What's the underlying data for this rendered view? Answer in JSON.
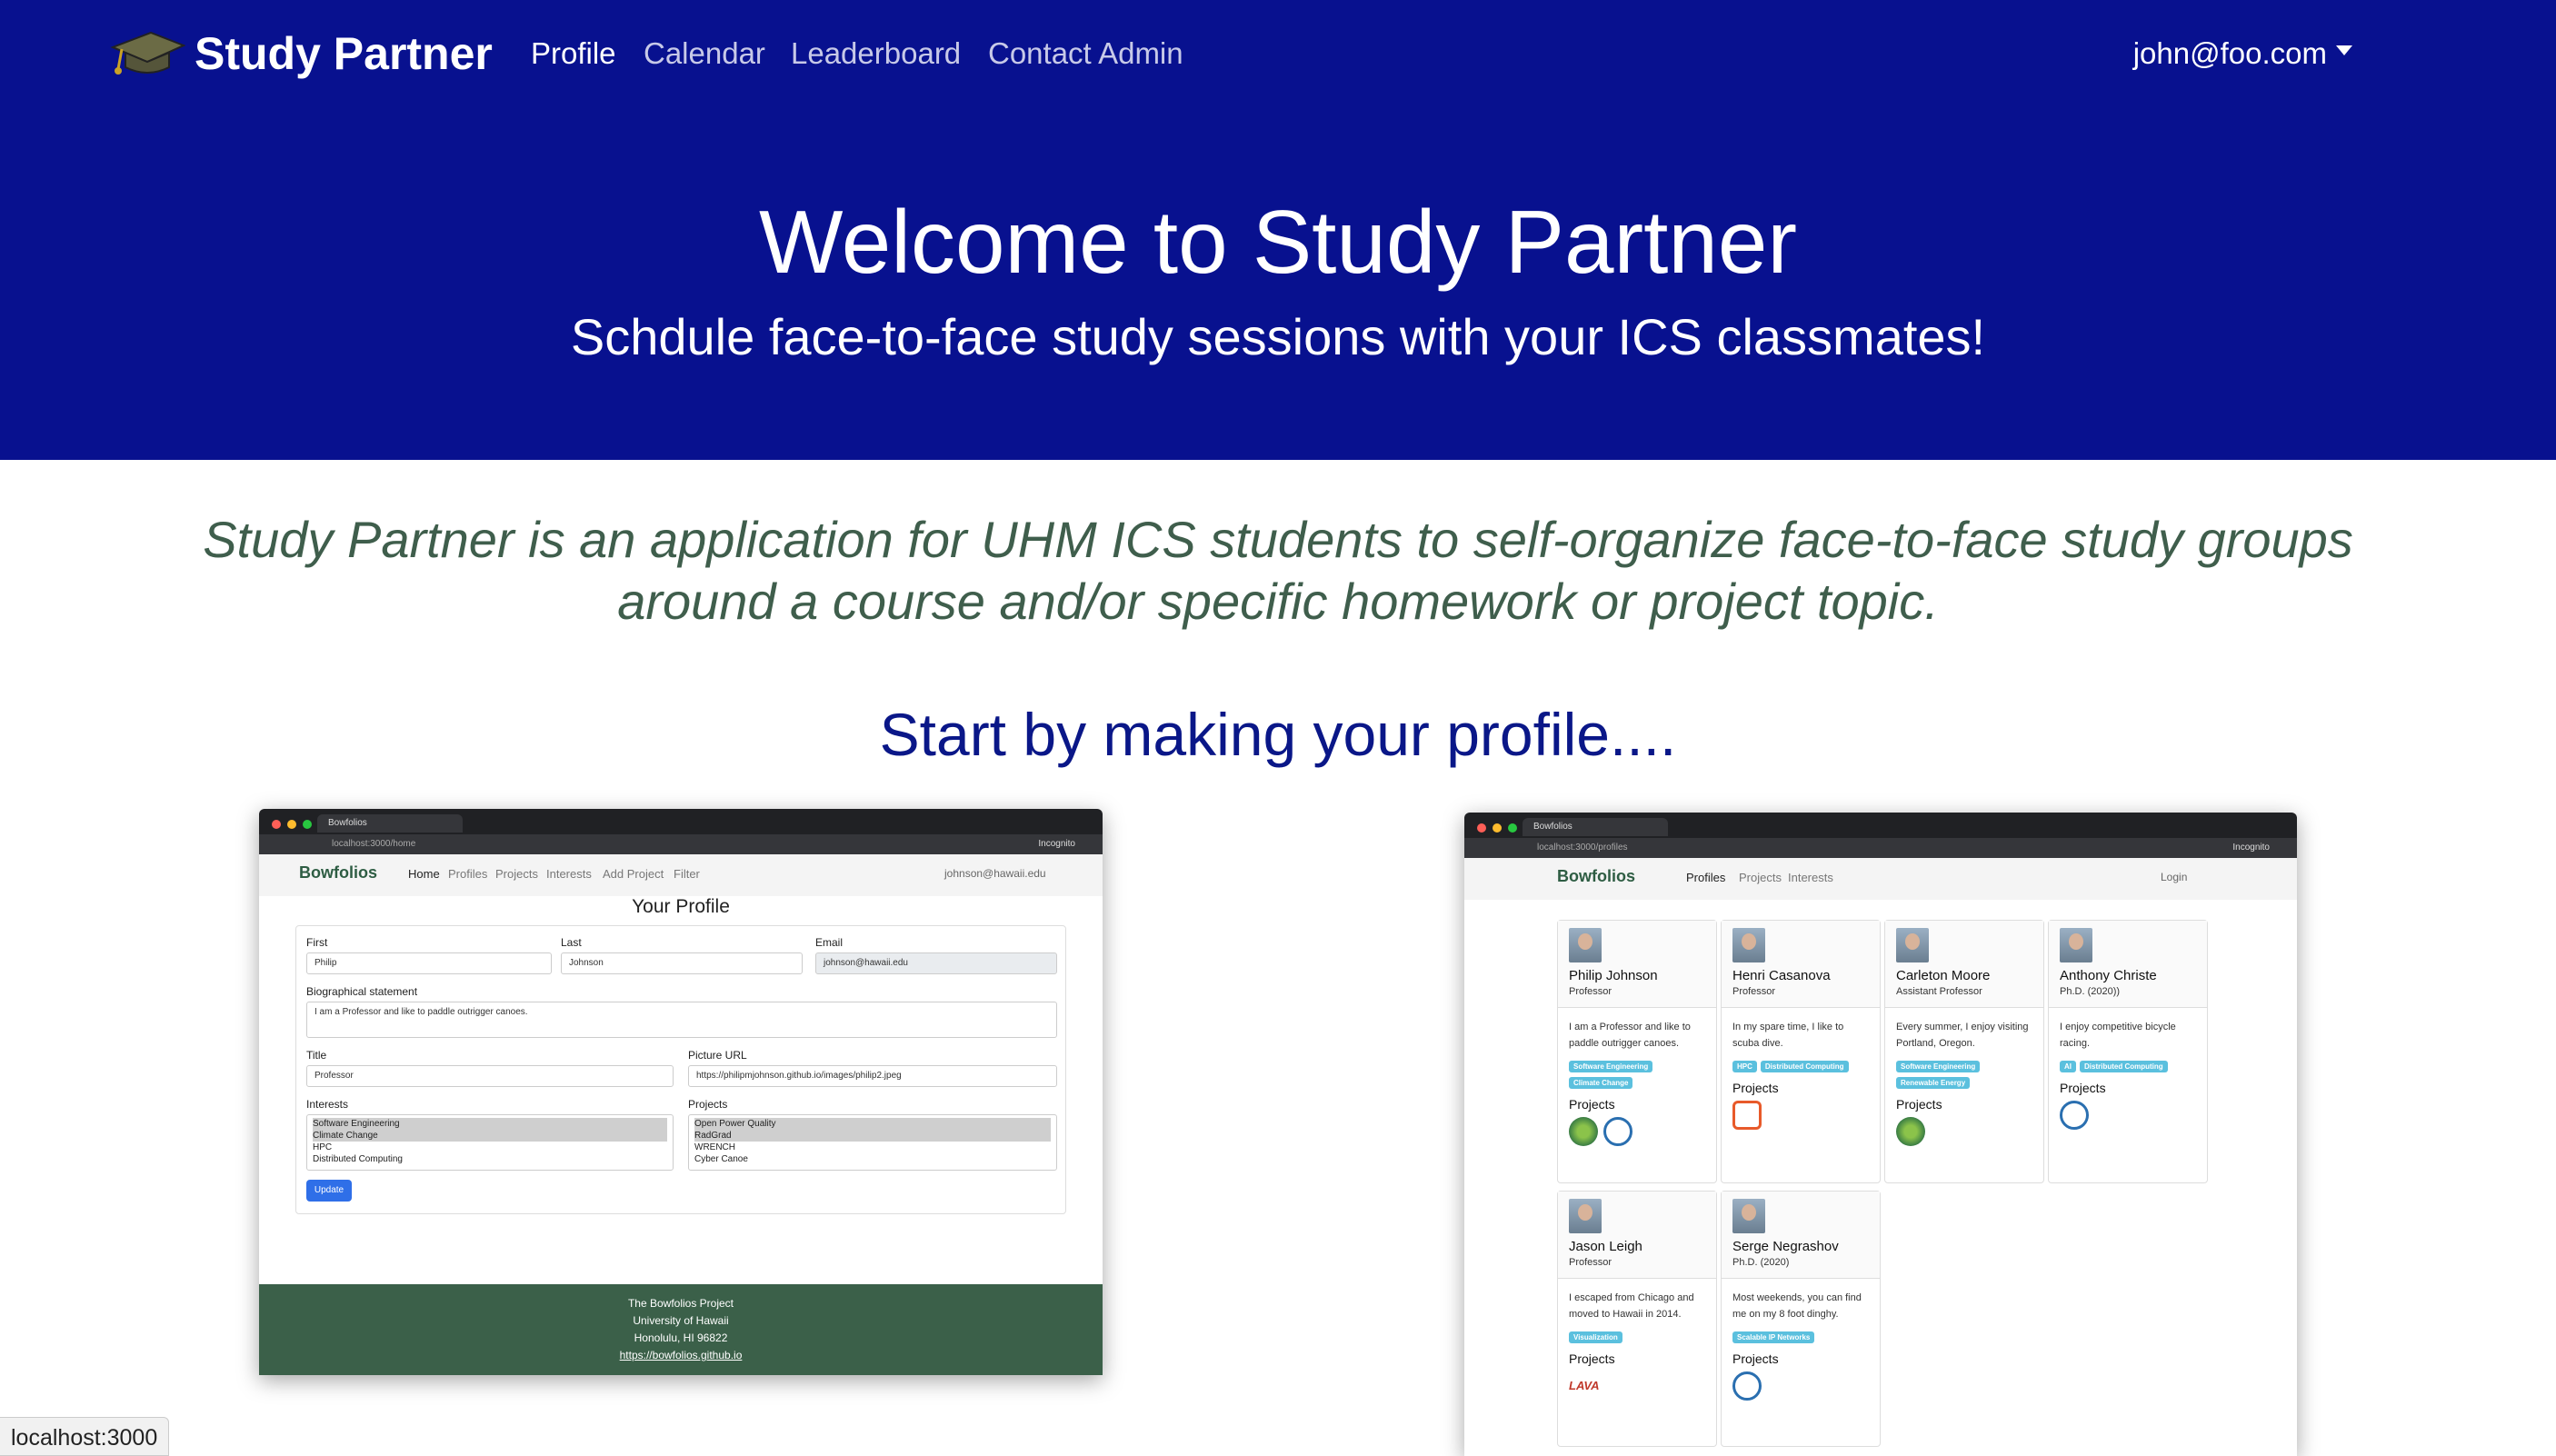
{
  "navbar": {
    "brand": "Study Partner",
    "links": [
      "Profile",
      "Calendar",
      "Leaderboard",
      "Contact Admin"
    ],
    "user": "john@foo.com"
  },
  "hero": {
    "title": "Welcome to Study Partner",
    "subtitle": "Schdule face-to-face study sessions with your ICS classmates!"
  },
  "tagline_line1": "Study Partner is an application for UHM ICS students to self-organize face-to-face study groups",
  "tagline_line2": "around a course and/or specific homework or project topic.",
  "section_heading": "Start by making your profile....",
  "shot_left": {
    "tab": "Bowfolios",
    "url": "localhost:3000/home",
    "incognito": "Incognito",
    "brand": "Bowfolios",
    "nav": [
      "Home",
      "Profiles",
      "Projects",
      "Interests",
      "Add Project",
      "Filter"
    ],
    "user": "johnson@hawaii.edu",
    "title": "Your Profile",
    "labels": {
      "first": "First",
      "last": "Last",
      "email": "Email",
      "bio": "Biographical statement",
      "title": "Title",
      "picture": "Picture URL",
      "interests": "Interests",
      "projects": "Projects"
    },
    "values": {
      "first": "Philip",
      "last": "Johnson",
      "email": "johnson@hawaii.edu",
      "bio": "I am a Professor and like to paddle outrigger canoes.",
      "title": "Professor",
      "picture": "https://philipmjohnson.github.io/images/philip2.jpeg"
    },
    "interests": [
      "Software Engineering",
      "Climate Change",
      "HPC",
      "Distributed Computing"
    ],
    "projects": [
      "Open Power Quality",
      "RadGrad",
      "WRENCH",
      "Cyber Canoe"
    ],
    "button": "Update",
    "footer": [
      "The Bowfolios Project",
      "University of Hawaii",
      "Honolulu, HI 96822",
      "https://bowfolios.github.io"
    ]
  },
  "shot_right": {
    "tab": "Bowfolios",
    "url": "localhost:3000/profiles",
    "incognito": "Incognito",
    "brand": "Bowfolios",
    "nav": [
      "Profiles",
      "Projects",
      "Interests"
    ],
    "login": "Login",
    "projects_label": "Projects",
    "cards": [
      {
        "name": "Philip Johnson",
        "role": "Professor",
        "bio": "I am a Professor and like to paddle outrigger canoes.",
        "tags": [
          "Software Engineering",
          "Climate Change"
        ]
      },
      {
        "name": "Henri Casanova",
        "role": "Professor",
        "bio": "In my spare time, I like to scuba dive.",
        "tags": [
          "HPC",
          "Distributed Computing"
        ]
      },
      {
        "name": "Carleton Moore",
        "role": "Assistant Professor",
        "bio": "Every summer, I enjoy visiting Portland, Oregon.",
        "tags": [
          "Software Engineering",
          "Renewable Energy"
        ]
      },
      {
        "name": "Anthony Christe",
        "role": "Ph.D. (2020))",
        "bio": "I enjoy competitive bicycle racing.",
        "tags": [
          "AI",
          "Distributed Computing"
        ]
      },
      {
        "name": "Jason Leigh",
        "role": "Professor",
        "bio": "I escaped from Chicago and moved to Hawaii in 2014.",
        "tags": [
          "Visualization"
        ]
      },
      {
        "name": "Serge Negrashov",
        "role": "Ph.D. (2020)",
        "bio": "Most weekends, you can find me on my 8 foot dinghy.",
        "tags": [
          "Scalable IP Networks"
        ]
      }
    ]
  },
  "status_bar": "localhost:3000",
  "colors": {
    "navy": "#08118f",
    "green": "#3f5e4c",
    "heading": "#0a1788"
  }
}
